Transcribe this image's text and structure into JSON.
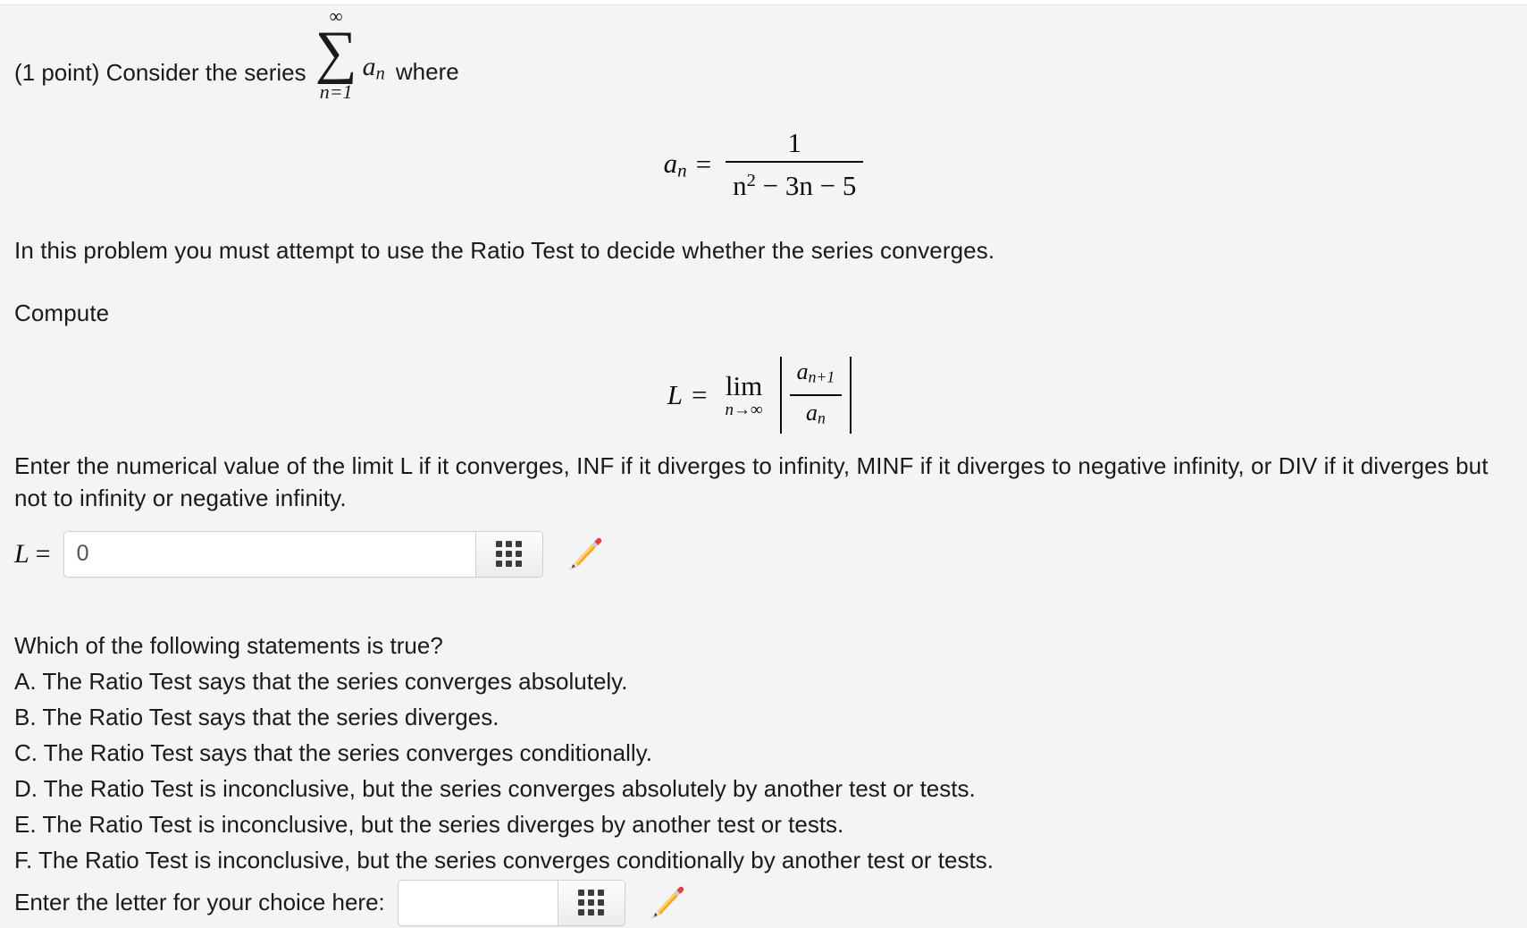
{
  "problem": {
    "points_label": "(1 point) Consider the series",
    "where_label": "where",
    "sum_upper": "∞",
    "sum_sigma": "∑",
    "sum_lower": "n=1",
    "sum_term": "a",
    "sum_term_sub": "n",
    "definition": {
      "lhs": "a",
      "lhs_sub": "n",
      "equals": "=",
      "numerator": "1",
      "denominator_base": "n",
      "denominator_exp": "2",
      "denominator_rest": " − 3n − 5"
    },
    "instruction": "In this problem you must attempt to use the Ratio Test to decide whether the series converges.",
    "compute_label": "Compute",
    "limit": {
      "lhs": "L",
      "equals": "=",
      "lim": "lim",
      "lim_sub": "n→∞",
      "numerator": "a",
      "numerator_sub": "n+1",
      "denominator": "a",
      "denominator_sub": "n"
    },
    "enter_value_text": "Enter the numerical value of the limit L if it converges, INF if it diverges to infinity, MINF if it diverges to negative infinity, or DIV if it diverges but not to infinity or negative infinity."
  },
  "limit_answer": {
    "label_var": "L",
    "label_eq": "=",
    "value": "0",
    "placeholder": "",
    "keypad_icon": "keypad-grid-icon",
    "pencil_icon": "pencil-icon"
  },
  "multiple_choice": {
    "question": "Which of the following statements is true?",
    "options": [
      "A. The Ratio Test says that the series converges absolutely.",
      "B. The Ratio Test says that the series diverges.",
      "C. The Ratio Test says that the series converges conditionally.",
      "D. The Ratio Test is inconclusive, but the series converges absolutely by another test or tests.",
      "E. The Ratio Test is inconclusive, but the series diverges by another test or tests.",
      "F. The Ratio Test is inconclusive, but the series converges conditionally by another test or tests."
    ]
  },
  "choice_answer": {
    "label": "Enter the letter for your choice here:",
    "value": "",
    "placeholder": "",
    "keypad_icon": "keypad-grid-icon",
    "pencil_icon": "pencil-icon"
  },
  "colors": {
    "page_background": "#f4f4f4",
    "text": "#1a1a1a",
    "input_border": "#cfcfcf",
    "keypad_dot": "#3c3c3c",
    "pencil_body": "#f0a830",
    "pencil_eraser": "#e24a4a"
  }
}
